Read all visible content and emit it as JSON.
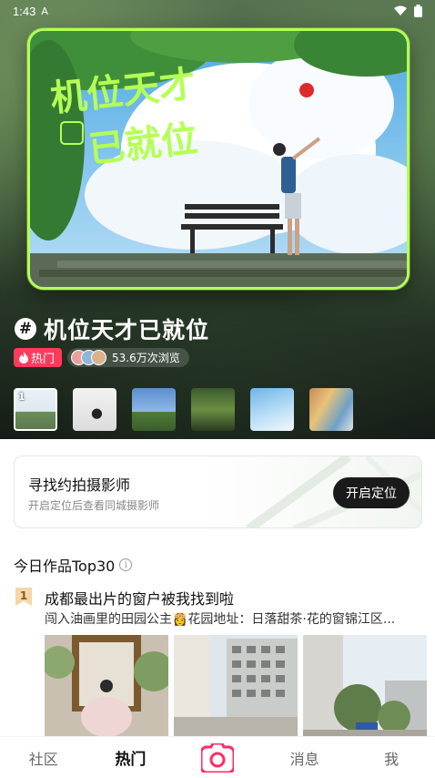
{
  "status_bar": {
    "time": "1:43",
    "extra": "A"
  },
  "banner": {
    "art_text_line1": "机位天才",
    "art_text_line2": "已就位"
  },
  "topic": {
    "hash_symbol": "#",
    "title": "机位天才已就位",
    "hot_label": "热门",
    "views": "53.6万次浏览"
  },
  "thumbnails": [
    {
      "rank": "1"
    },
    {
      "rank": ""
    },
    {
      "rank": ""
    },
    {
      "rank": ""
    },
    {
      "rank": ""
    },
    {
      "rank": ""
    }
  ],
  "finder": {
    "title": "寻找约拍摄影师",
    "subtitle": "开启定位后查看同城摄影师",
    "button": "开启定位"
  },
  "top_section": {
    "title": "今日作品Top30",
    "info_symbol": "i"
  },
  "post": {
    "rank": "1",
    "title": "成都最出片的窗户被我找到啦",
    "description": "闯入油画里的田园公主👸花园地址：日落甜茶·花的窗锦江区..."
  },
  "bottom_nav": {
    "items": [
      {
        "label": "社区"
      },
      {
        "label": "热门"
      },
      {
        "label": "消息"
      },
      {
        "label": "我"
      }
    ]
  },
  "colors": {
    "accent_green": "#b5ff56",
    "hot_red": "#ff3b5c",
    "camera_pink": "#ff2e63"
  }
}
